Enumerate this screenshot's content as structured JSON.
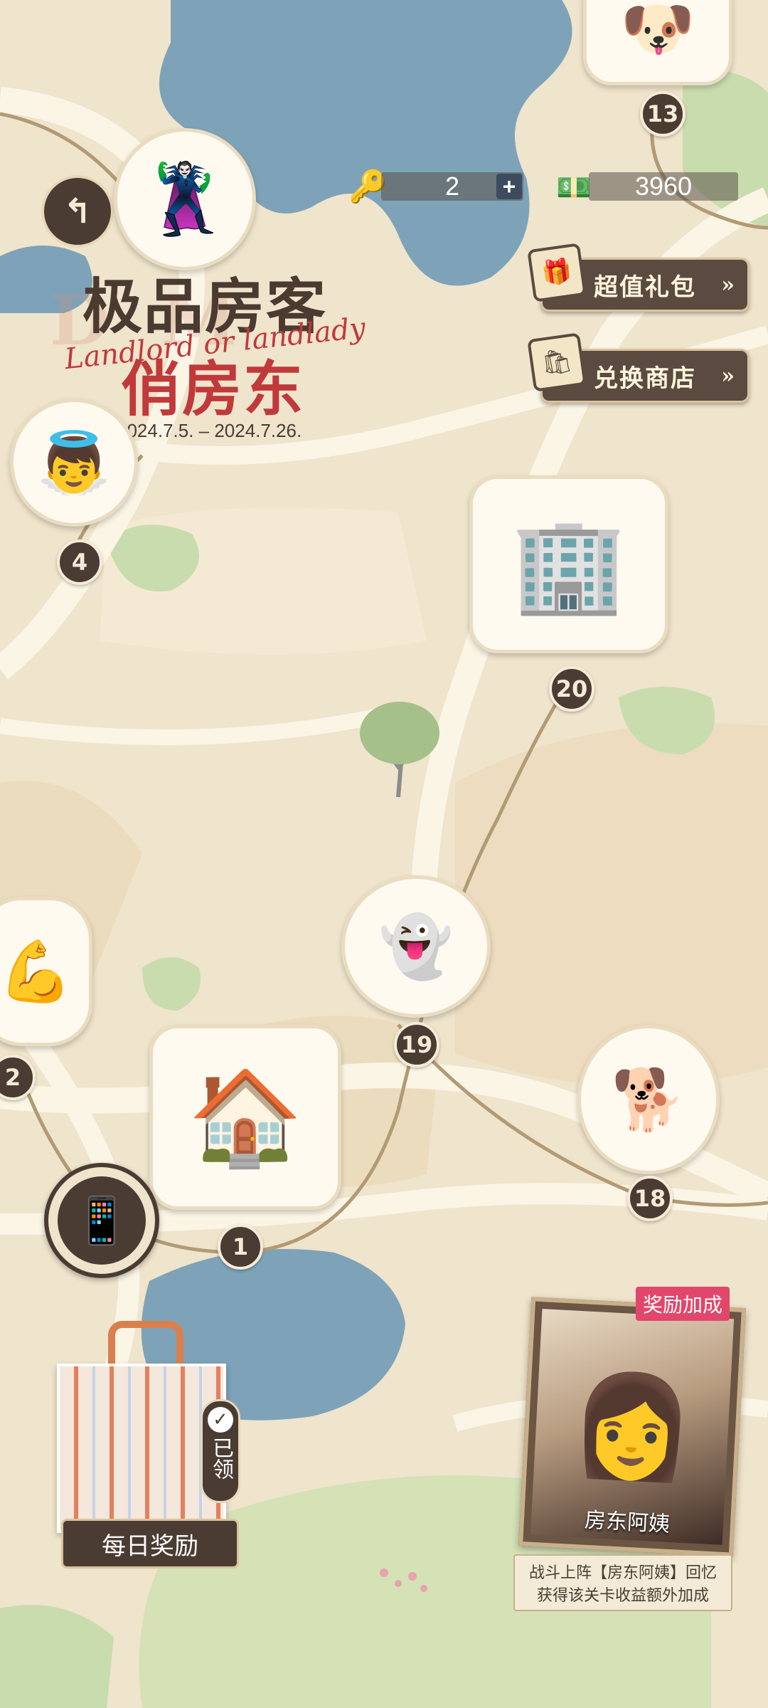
{
  "header": {
    "back_icon": "back-arrow-icon",
    "title_line1": "极品房客",
    "title_line2": "俏房东",
    "subtitle_script": "Landlord or landlady",
    "date_range": "2024.7.5. – 2024.7.26.",
    "info_icon": "info-icon"
  },
  "resources": {
    "keys": {
      "icon": "key-icon",
      "value": "2",
      "add_label": "+"
    },
    "cash": {
      "icon": "cash-icon",
      "value": "3960"
    }
  },
  "side_buttons": [
    {
      "label": "超值礼包",
      "chevron": "»",
      "icon": "gift-box-icon"
    },
    {
      "label": "兑换商店",
      "chevron": "»",
      "icon": "shop-bag-icon"
    }
  ],
  "map_nodes": [
    "1",
    "2",
    "4",
    "13",
    "18",
    "19",
    "20"
  ],
  "daily_reward": {
    "label": "每日奖励",
    "claimed_label": "已领",
    "check_icon": "check-icon"
  },
  "phone_button": {
    "icon": "phone-message-icon"
  },
  "bonus_card": {
    "tag": "奖励加成",
    "character_name": "房东阿姨",
    "description_line1": "战斗上阵【房东阿姨】回忆",
    "description_line2": "获得该关卡收益额外加成"
  },
  "colors": {
    "dark_brown": "#4b3c33",
    "cream": "#f5ecd8",
    "water": "#7ea3b8",
    "park": "#c9dcae",
    "road": "#fbf5e6",
    "pink_tag": "#e2466a"
  }
}
